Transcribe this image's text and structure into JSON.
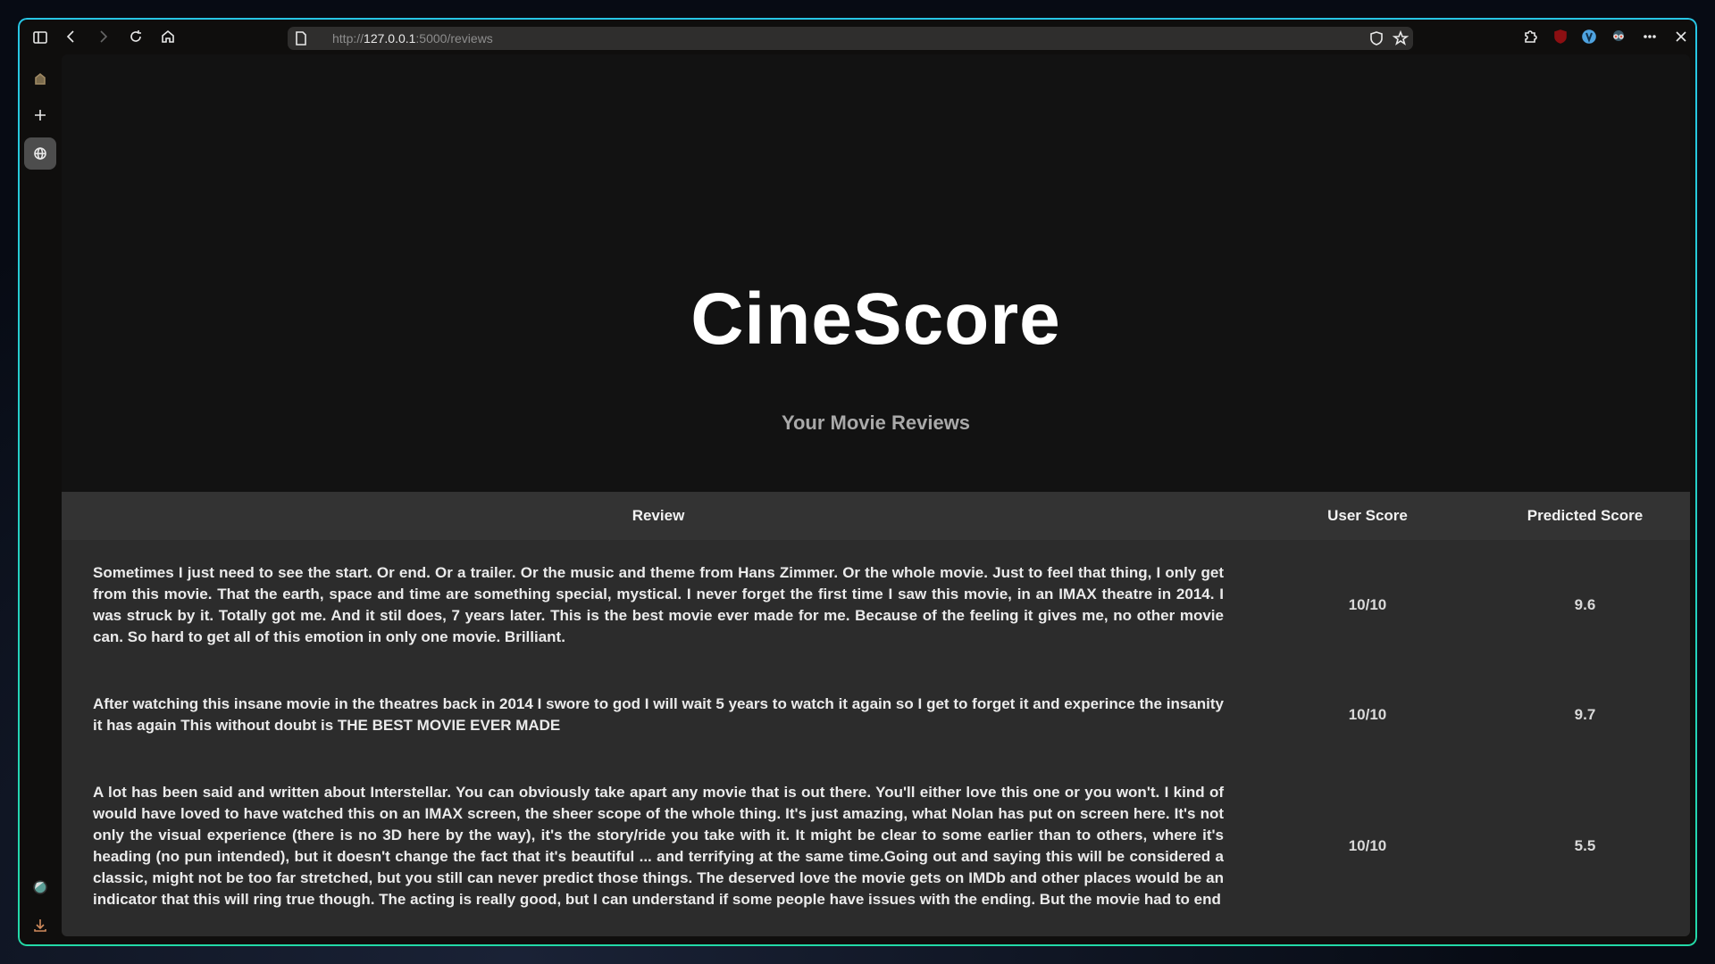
{
  "browser": {
    "url_prefix": "http://",
    "url_host": "127.0.0.1",
    "url_path": ":5000/reviews"
  },
  "page": {
    "title": "CineScore",
    "subtitle": "Your Movie Reviews"
  },
  "table": {
    "headers": [
      "Review",
      "User Score",
      "Predicted Score"
    ],
    "rows": [
      {
        "review": "Sometimes I just need to see the start. Or end. Or a trailer. Or the music and theme from Hans Zimmer. Or the whole movie. Just to feel that thing, I only get from this movie. That the earth, space and time are something special, mystical. I never forget the first time I saw this movie, in an IMAX theatre in 2014. I was struck by it. Totally got me. And it stil does, 7 years later. This is the best movie ever made for me. Because of the feeling it gives me, no other movie can. So hard to get all of this emotion in only one movie. Brilliant.",
        "user_score": "10/10",
        "predicted_score": "9.6"
      },
      {
        "review": "After watching this insane movie in the theatres back in 2014 I swore to god I will wait 5 years to watch it again so I get to forget it and experince the insanity it has again This without doubt is THE BEST MOVIE EVER MADE",
        "user_score": "10/10",
        "predicted_score": "9.7"
      },
      {
        "review": "A lot has been said and written about Interstellar. You can obviously take apart any movie that is out there. You'll either love this one or you won't. I kind of would have loved to have watched this on an IMAX screen, the sheer scope of the whole thing. It's just amazing, what Nolan has put on screen here. It's not only the visual experience (there is no 3D here by the way), it's the story/ride you take with it. It might be clear to some earlier than to others, where it's heading (no pun intended), but it doesn't change the fact that it's beautiful ... and terrifying at the same time.Going out and saying this will be considered a classic, might not be too far stretched, but you still can never predict those things. The deserved love the movie gets on IMDb and other places would be an indicator that this will ring true though. The acting is really good, but I can understand if some people have issues with the ending. But the movie had to end",
        "user_score": "10/10",
        "predicted_score": "5.5"
      }
    ]
  }
}
